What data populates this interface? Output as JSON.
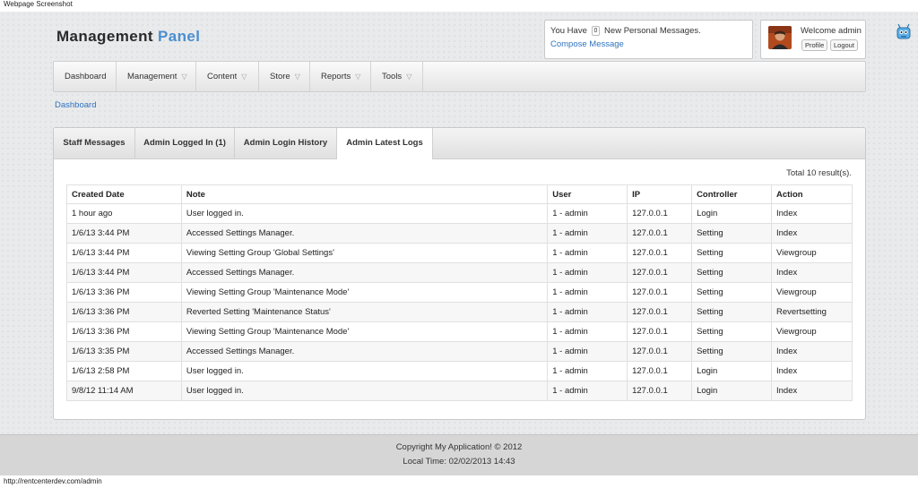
{
  "window": {
    "title": "Webpage Screenshot"
  },
  "header": {
    "logo_main": "Management",
    "logo_accent": "Panel",
    "messages_prefix": "You Have",
    "messages_count": "0",
    "messages_suffix": "New Personal Messages.",
    "compose_label": "Compose Message",
    "welcome": "Welcome admin",
    "profile_label": "Profile",
    "logout_label": "Logout"
  },
  "nav": {
    "items": [
      {
        "label": "Dashboard",
        "caret": ""
      },
      {
        "label": "Management",
        "caret": "▽"
      },
      {
        "label": "Content",
        "caret": "▽"
      },
      {
        "label": "Store",
        "caret": "▽"
      },
      {
        "label": "Reports",
        "caret": "▽"
      },
      {
        "label": "Tools",
        "caret": "▽"
      }
    ]
  },
  "breadcrumb": {
    "label": "Dashboard"
  },
  "tabs": [
    {
      "label": "Staff Messages"
    },
    {
      "label": "Admin Logged In (1)"
    },
    {
      "label": "Admin Login History"
    },
    {
      "label": "Admin Latest Logs"
    }
  ],
  "active_tab": "Admin Latest Logs",
  "table": {
    "total_text": "Total 10 result(s).",
    "columns": [
      "Created Date",
      "Note",
      "User",
      "IP",
      "Controller",
      "Action"
    ],
    "rows": [
      [
        "1 hour ago",
        "User logged in.",
        "1 - admin",
        "127.0.0.1",
        "Login",
        "Index"
      ],
      [
        "1/6/13 3:44 PM",
        "Accessed Settings Manager.",
        "1 - admin",
        "127.0.0.1",
        "Setting",
        "Index"
      ],
      [
        "1/6/13 3:44 PM",
        "Viewing Setting Group 'Global Settings'",
        "1 - admin",
        "127.0.0.1",
        "Setting",
        "Viewgroup"
      ],
      [
        "1/6/13 3:44 PM",
        "Accessed Settings Manager.",
        "1 - admin",
        "127.0.0.1",
        "Setting",
        "Index"
      ],
      [
        "1/6/13 3:36 PM",
        "Viewing Setting Group 'Maintenance Mode'",
        "1 - admin",
        "127.0.0.1",
        "Setting",
        "Viewgroup"
      ],
      [
        "1/6/13 3:36 PM",
        "Reverted Setting 'Maintenance Status'",
        "1 - admin",
        "127.0.0.1",
        "Setting",
        "Revertsetting"
      ],
      [
        "1/6/13 3:36 PM",
        "Viewing Setting Group 'Maintenance Mode'",
        "1 - admin",
        "127.0.0.1",
        "Setting",
        "Viewgroup"
      ],
      [
        "1/6/13 3:35 PM",
        "Accessed Settings Manager.",
        "1 - admin",
        "127.0.0.1",
        "Setting",
        "Index"
      ],
      [
        "1/6/13 2:58 PM",
        "User logged in.",
        "1 - admin",
        "127.0.0.1",
        "Login",
        "Index"
      ],
      [
        "9/8/12 11:14 AM",
        "User logged in.",
        "1 - admin",
        "127.0.0.1",
        "Login",
        "Index"
      ]
    ]
  },
  "footer": {
    "copyright": "Copyright My Application! © 2012",
    "local_time": "Local Time: 02/02/2013 14:43"
  },
  "status_bar": {
    "url": "http://rentcenterdev.com/admin"
  },
  "colors": {
    "accent": "#4a8fd0",
    "link": "#2f74c0"
  },
  "icons": {
    "robot": "robot-icon",
    "avatar": "user-avatar"
  }
}
